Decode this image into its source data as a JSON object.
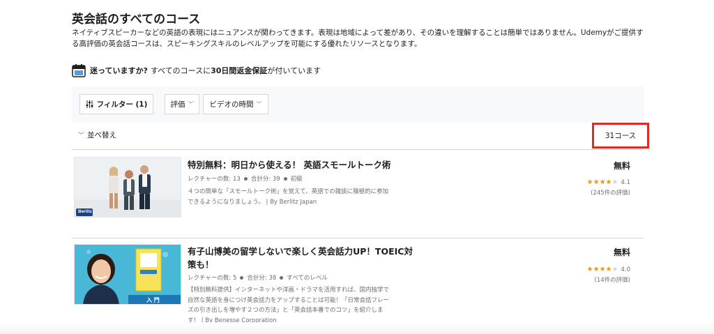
{
  "page": {
    "title": "英会話のすべてのコース",
    "description": "ネイティブスピーカーなどの英語の表現にはニュアンスが関わってきます。表現は地域によって差があり、その違いを理解することは簡単ではありません。Udemyがご提供する高評価の英会話コースは、スピーキングスキルのレベルアップを可能にする優れたリソースとなります。"
  },
  "guarantee": {
    "lead": "迷っていますか?",
    "mid": "すべてのコースに",
    "bold": "30日間返金保証",
    "tail": "が付いています",
    "icon": "calendar-30-icon"
  },
  "filters": {
    "filter_label": "フィルター (1)",
    "rating_label": "評価",
    "video_label": "ビデオの時間"
  },
  "sort": {
    "label": "並べ替え"
  },
  "results": {
    "count": "31コース",
    "highlight_color": "#e02b20"
  },
  "courses": [
    {
      "title": "特別無料：明日から使える！ 英語スモールトーク術",
      "lectures": "レクチャーの数: 13",
      "total": "合計分: 39",
      "level": "初級",
      "description": "４つの簡単な「スモールトーク術」を覚えて、英語での雑談に積極的に参加できるようになりましょう。 | By Berlitz Japan",
      "price": "無料",
      "stars": 4,
      "rating": "4.1",
      "reviews": "(245件の評価)",
      "thumb_badge": "Berlitz"
    },
    {
      "title": "有子山博美の留学しないで楽しく英会話力UP！TOEIC対策も！",
      "lectures": "レクチャーの数: 5",
      "total": "合計分: 38",
      "level": "すべてのレベル",
      "description": "【特別無料提供】インターネットや洋画・ドラマを活用すれば、国内独学で自然な英語を身につけ英会話力をアップすることは可能！「日常会話フレーズの引き出しを増やす２つの方法」と「英会話本番でのコツ」を紹介します！ | By Benesse Corporation",
      "price": "無料",
      "stars": 4,
      "rating": "4.0",
      "reviews": "(14件の評価)",
      "thumb_label": "入 門"
    }
  ],
  "colors": {
    "star": "#e59819",
    "text_gray": "#6a6f73"
  }
}
